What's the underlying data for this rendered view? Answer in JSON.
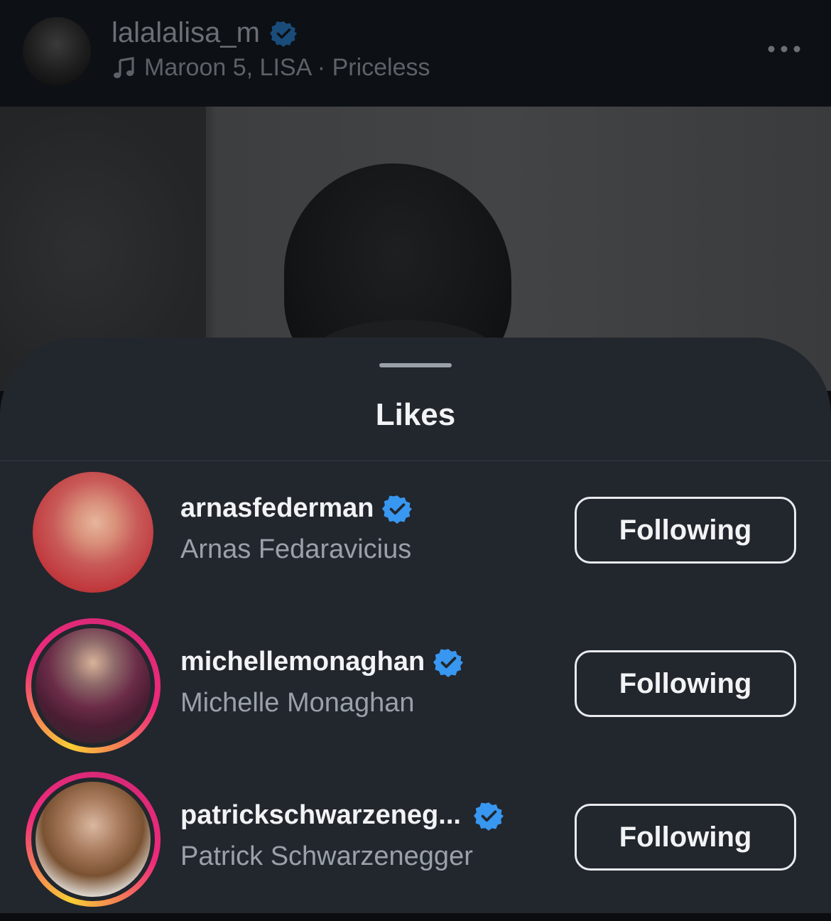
{
  "post": {
    "username": "lalalalisa_m",
    "music": "Maroon 5, LISA · Priceless"
  },
  "likes_sheet": {
    "title": "Likes",
    "users": [
      {
        "username": "arnasfederman",
        "full_name": "Arnas Fedaravicius",
        "button": "Following",
        "story_ring": false
      },
      {
        "username": "michellemonaghan",
        "full_name": "Michelle Monaghan",
        "button": "Following",
        "story_ring": true
      },
      {
        "username": "patrickschwarzeneg...",
        "full_name": "Patrick Schwarzenegger",
        "button": "Following",
        "story_ring": true
      }
    ]
  },
  "icons": {
    "verified": "verified-badge-icon",
    "music": "music-note-icon",
    "more": "more-options-icon"
  },
  "colors": {
    "background": "#22262d",
    "verified_blue": "#3897f0",
    "story_ring_start": "#f9ce34",
    "story_ring_end": "#ee2a7b"
  }
}
